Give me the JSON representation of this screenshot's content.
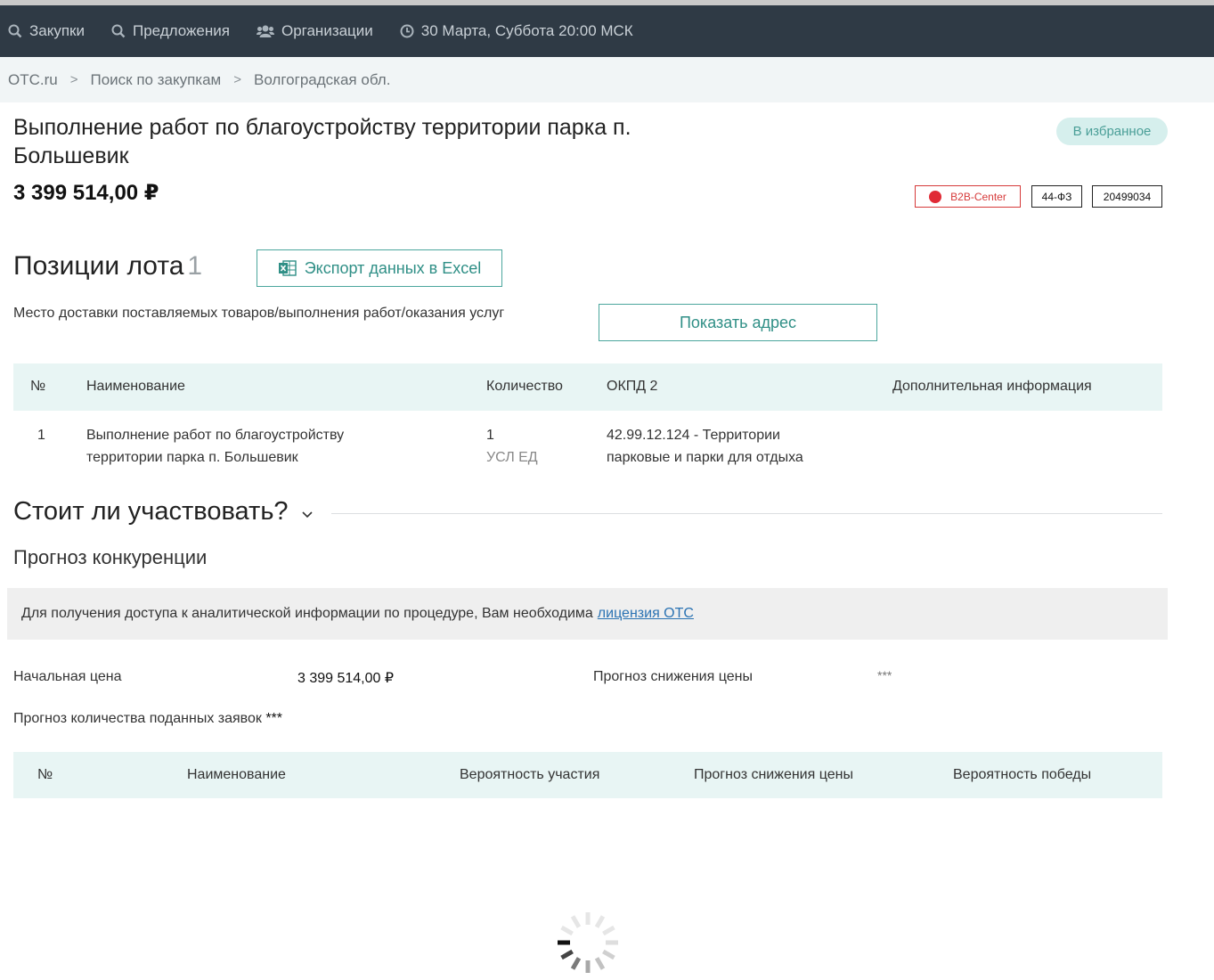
{
  "nav": {
    "purchases": "Закупки",
    "offers": "Предложения",
    "organizations": "Организации",
    "datetime": "30 Марта, Суббота 20:00 МСК"
  },
  "breadcrumb": {
    "home": "OTC.ru",
    "search": "Поиск по закупкам",
    "region": "Волгоградская обл.",
    "separator": ">"
  },
  "tender": {
    "title": "Выполнение работ по благоустройству территории парка п. Большевик",
    "price": "3 399 514,00 ₽",
    "favorite_label": "В избранное",
    "platform_badge": "B2B-Center",
    "law_badge": "44-ФЗ",
    "number_badge": "20499034",
    "platform_color": "#e02a35"
  },
  "lot": {
    "heading": "Позиции лота",
    "count": "1",
    "export_label": "Экспорт данных в Excel",
    "delivery_label": "Место доставки поставляемых товаров/выполнения работ/оказания услуг",
    "show_address_label": "Показать адрес",
    "columns": [
      "№",
      "Наименование",
      "Количество",
      "ОКПД 2",
      "Дополнительная информация"
    ],
    "rows": [
      {
        "num": "1",
        "name_line1": "Выполнение работ по благоустройству",
        "name_line2": "территории парка п. Большевик",
        "qty": "1",
        "unit": "УСЛ ЕД",
        "okpd_line1": "42.99.12.124 - Территории",
        "okpd_line2": "парковые и парки для отдыха",
        "extra": ""
      }
    ]
  },
  "analysis": {
    "heading": "Стоит ли участвовать?",
    "forecast_heading": "Прогноз конкуренции",
    "notice_text": "Для получения доступа к аналитической информации по процедуре, Вам необходима",
    "notice_link": "лицензия ОТС",
    "start_price_label": "Начальная цена",
    "start_price_value": "3 399 514,00 ₽",
    "price_drop_label": "Прогноз снижения цены",
    "price_drop_value": "***",
    "bids_label": "Прогноз количества поданных заявок",
    "bids_value": "***",
    "columns": [
      "№",
      "Наименование",
      "Вероятность участия",
      "Прогноз снижения цены",
      "Вероятность победы"
    ]
  },
  "colors": {
    "nav_bg": "#2f3a45",
    "accent": "#4ba69d",
    "table_head_bg": "#e8f5f4"
  }
}
